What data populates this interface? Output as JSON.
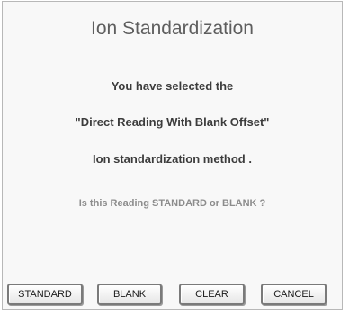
{
  "dialog": {
    "title": "Ion Standardization",
    "message_line1": "You have selected  the",
    "message_line2": "\"Direct Reading With Blank Offset\"",
    "message_line3": "Ion standardization method .",
    "question": "Is this Reading STANDARD or BLANK  ?"
  },
  "buttons": {
    "standard": "STANDARD",
    "blank": "BLANK",
    "clear": "CLEAR",
    "cancel": "CANCEL"
  }
}
